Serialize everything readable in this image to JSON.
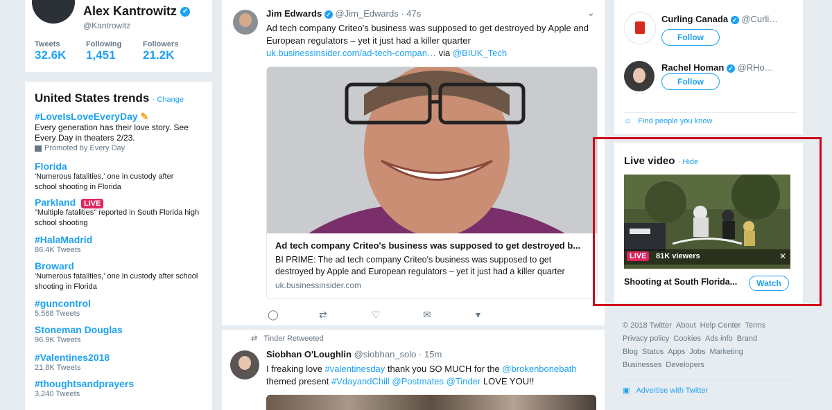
{
  "profile": {
    "name": "Alex Kantrowitz",
    "handle": "@Kantrowitz",
    "stats": [
      {
        "label": "Tweets",
        "value": "32.6K"
      },
      {
        "label": "Following",
        "value": "1,451"
      },
      {
        "label": "Followers",
        "value": "21.2K"
      }
    ]
  },
  "trends": {
    "title": "United States trends",
    "change_label": "· Change",
    "items": [
      {
        "name": "#LoveIsLoveEveryDay",
        "desc": "Every generation has their love story. See Every Day in theaters 2/23.",
        "promoted": "Promoted by Every Day"
      },
      {
        "name": "Florida",
        "desc": "'Numerous fatalities,' one in custody after school shooting in Florida"
      },
      {
        "name": "Parkland",
        "badge": "LIVE",
        "desc": "\"Multiple fatalities\" reported in South Florida high school shooting"
      },
      {
        "name": "#HalaMadrid",
        "desc": "86.4K Tweets"
      },
      {
        "name": "Broward",
        "desc": "'Numerous fatalities,' one in custody after school shooting in Florida"
      },
      {
        "name": "#guncontrol",
        "desc": "5,568 Tweets"
      },
      {
        "name": "Stoneman Douglas",
        "desc": "96.9K Tweets"
      },
      {
        "name": "#Valentines2018",
        "desc": "21.8K Tweets"
      },
      {
        "name": "#thoughtsandprayers",
        "desc": "3,240 Tweets"
      }
    ]
  },
  "tweet1": {
    "name": "Jim Edwards",
    "handle": "@Jim_Edwards",
    "time": "· 47s",
    "text": "Ad tech company Criteo's business was supposed to get destroyed by Apple and European regulators – yet it just had a killer quarter",
    "link": "uk.businessinsider.com/ad-tech-compan…",
    "via": "via",
    "via_handle": "@BIUK_Tech",
    "card_title": "Ad tech company Criteo's business was supposed to get destroyed b...",
    "card_desc": "BI PRIME: The ad tech company Criteo's business was supposed to get destroyed by Apple and European regulators – yet it just had a killer quarter",
    "card_domain": "uk.businessinsider.com"
  },
  "tweet2": {
    "retweeted_by": "Tinder Retweeted",
    "name": "Siobhan O'Loughlin",
    "handle": "@siobhan_solo",
    "time": "· 15m",
    "text_parts": {
      "p1": "I freaking love ",
      "h1": "#valentinesday",
      "p2": " thank you SO MUCH for the ",
      "h2": "@brokenbonebath",
      "p3": "themed present ",
      "h3": "#VdayandChill",
      "h4": "@Postmates",
      "h5": "@Tinder",
      "p4": " LOVE YOU!!"
    }
  },
  "who_to_follow": [
    {
      "name": "Curling Canada",
      "handle": "@Curli…",
      "button": "Follow"
    },
    {
      "name": "Rachel Homan",
      "handle": "@RHo…",
      "button": "Follow"
    }
  ],
  "find_people": "Find people you know",
  "live_video": {
    "title": "Live video",
    "hide_label": "· Hide",
    "live_badge": "LIVE",
    "viewers": "81K viewers",
    "caption": "Shooting at South Florida...",
    "watch_label": "Watch",
    "highlight_color": "#d0021b"
  },
  "footer": {
    "links": [
      "© 2018 Twitter",
      "About",
      "Help Center",
      "Terms",
      "Privacy policy",
      "Cookies",
      "Ads info",
      "Brand",
      "Blog",
      "Status",
      "Apps",
      "Jobs",
      "Marketing",
      "Businesses",
      "Developers"
    ],
    "advertise": "Advertise with Twitter"
  },
  "colors": {
    "accent": "#1da1f2",
    "background": "#e6ecf0",
    "live": "#e0245e"
  }
}
